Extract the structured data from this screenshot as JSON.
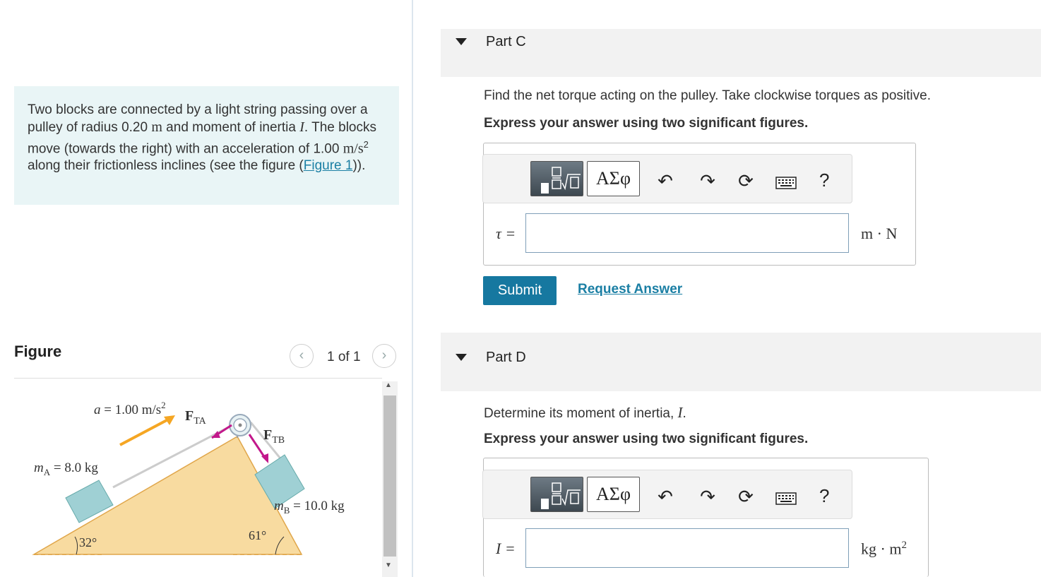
{
  "problem": {
    "t1": "Two blocks are connected by a light string passing over a pulley of radius 0.20 ",
    "u1": "m",
    "t2": " and moment of inertia ",
    "v1": "I",
    "t3": ". The blocks move (towards the right) with an acceleration of 1.00 ",
    "u2": "m/s",
    "sup": "2",
    "t4": " along their frictionless inclines (see the figure (",
    "link": "Figure 1",
    "t5": "))."
  },
  "figure": {
    "heading": "Figure",
    "pager": "1 of 1",
    "accel": "a = 1.00 m/s",
    "accel_sup": "2",
    "fta": "F",
    "fta_sub": "TA",
    "ftb": "F",
    "ftb_sub": "TB",
    "ma": "m",
    "ma_sub": "A",
    "ma_val": " = 8.0 kg",
    "mb": "m",
    "mb_sub": "B",
    "mb_val": " = 10.0 kg",
    "angle_left": "32°",
    "angle_right": "61°"
  },
  "partC": {
    "title": "Part C",
    "question": "Find the net torque acting on the pulley. Take clockwise torques as positive.",
    "instruction": "Express your answer using two significant figures.",
    "var": "τ =",
    "unit": "m · N",
    "input_value": "",
    "submit": "Submit",
    "request": "Request Answer"
  },
  "partD": {
    "title": "Part D",
    "question": "Determine its moment of inertia, ",
    "question_var": "I",
    "question_end": ".",
    "instruction": "Express your answer using two significant figures.",
    "var": "I =",
    "unit": "kg · m",
    "unit_sup": "2",
    "input_value": ""
  },
  "toolbar": {
    "greek": "ΑΣφ",
    "help": "?"
  },
  "colors": {
    "accent": "#1678a0",
    "link": "#1b7fa4",
    "problem_bg": "#e9f5f6",
    "incline": "#f8dba0",
    "block": "#9fd0d4",
    "arrow_orange": "#f5a623",
    "arrow_magenta": "#c2188b"
  },
  "icons": [
    "caret-down-icon",
    "templates-icon",
    "greek-letters-icon",
    "undo-icon",
    "redo-icon",
    "reset-icon",
    "keyboard-icon",
    "help-icon",
    "chevron-left-icon",
    "chevron-right-icon"
  ]
}
